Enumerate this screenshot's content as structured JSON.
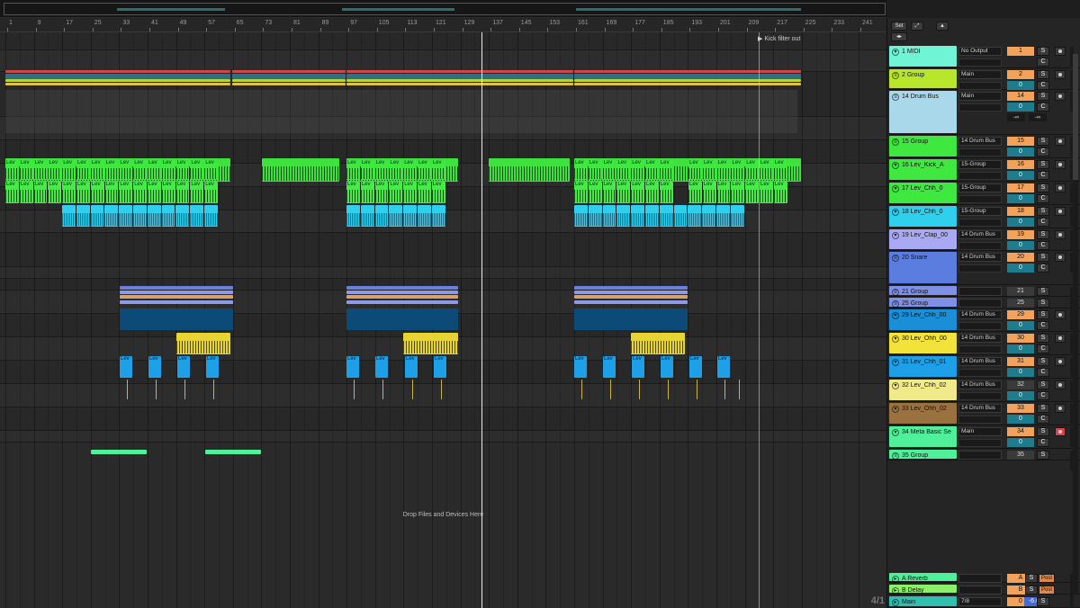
{
  "ruler": {
    "ticks": [
      "1",
      "9",
      "17",
      "25",
      "33",
      "41",
      "49",
      "57",
      "65",
      "73",
      "81",
      "89",
      "97",
      "105",
      "113",
      "121",
      "129",
      "137",
      "145",
      "153",
      "161",
      "169",
      "177",
      "185",
      "193",
      "201",
      "209",
      "217",
      "225",
      "233",
      "241"
    ]
  },
  "arrangement": {
    "locator_label": "Kick filter out",
    "drop_hint": "Drop Files and Devices Here",
    "time_signature": "4/1",
    "clip_label": "Lev"
  },
  "mixer": {
    "set_button": "Set",
    "tracks": [
      {
        "id": "t1",
        "name": "1 MIDI",
        "color": "#6ff5d6",
        "route": "No Output",
        "number": "1",
        "volume": "",
        "fold": "▾"
      },
      {
        "id": "t2",
        "name": "2 Group",
        "color": "#b7e62b",
        "route": "Main",
        "number": "2",
        "volume": "0",
        "fold": "≡"
      },
      {
        "id": "t14",
        "name": "14 Drum Bus",
        "color": "#a8d8ea",
        "route": "Main",
        "number": "14",
        "volume": "0",
        "fold": "≡",
        "inf_left": "-∞",
        "inf_right": "-∞"
      },
      {
        "id": "t15",
        "name": "15 Group",
        "color": "#3fe83f",
        "route": "14 Drum Bus",
        "number": "15",
        "volume": "0",
        "fold": "≡"
      },
      {
        "id": "t16",
        "name": "16 Lev_Kick_A",
        "color": "#3fe83f",
        "route": "15-Group",
        "number": "16",
        "volume": "0",
        "fold": "▾"
      },
      {
        "id": "t17",
        "name": "17 Lev_Chh_0",
        "color": "#3fe83f",
        "route": "15-Group",
        "number": "17",
        "volume": "0",
        "fold": "▾"
      },
      {
        "id": "t18",
        "name": "18 Lev_Chh_0",
        "color": "#2fd0ee",
        "route": "15-Group",
        "number": "18",
        "volume": "0",
        "fold": "▾"
      },
      {
        "id": "t19",
        "name": "19 Lev_Clap_00",
        "color": "#a9a9f3",
        "route": "14 Drum Bus",
        "number": "19",
        "volume": "0",
        "fold": "▾"
      },
      {
        "id": "t20",
        "name": "20 Snare",
        "color": "#5b7de0",
        "route": "14 Drum Bus",
        "number": "20",
        "volume": "0",
        "fold": "≡"
      },
      {
        "id": "t21",
        "name": "21 Group",
        "color": "#7f90e6",
        "route": "",
        "number": "21",
        "volume": "",
        "fold": "≡",
        "offnum": true
      },
      {
        "id": "t25",
        "name": "25 Group",
        "color": "#7f90e6",
        "route": "",
        "number": "25",
        "volume": "",
        "fold": "≡",
        "offnum": true
      },
      {
        "id": "t29",
        "name": "29 Lev_Chh_00",
        "color": "#1a8ed6",
        "route": "14 Drum Bus",
        "number": "29",
        "volume": "0",
        "fold": "▾"
      },
      {
        "id": "t30",
        "name": "30 Lev_Ohh_00",
        "color": "#f1e33a",
        "route": "14 Drum Bus",
        "number": "30",
        "volume": "0",
        "fold": "▾"
      },
      {
        "id": "t31",
        "name": "31 Lev_Chh_01",
        "color": "#1ea0e8",
        "route": "14 Drum Bus",
        "number": "31",
        "volume": "0",
        "fold": "▾"
      },
      {
        "id": "t32",
        "name": "32 Lev_Chh_02",
        "color": "#f1ea8a",
        "route": "14 Drum Bus",
        "number": "32",
        "volume": "0",
        "fold": "▾",
        "offnum": true
      },
      {
        "id": "t33",
        "name": "33 Lev_Ohh_02",
        "color": "#9a7240",
        "route": "14 Drum Bus",
        "number": "33",
        "volume": "0",
        "fold": "▾"
      },
      {
        "id": "t34",
        "name": "34 Meta Basic Se",
        "color": "#4ff09a",
        "route": "Main",
        "number": "34",
        "volume": "0",
        "fold": "▾",
        "armred": true
      },
      {
        "id": "t35",
        "name": "35 Group",
        "color": "#4ff09a",
        "route": "",
        "number": "35",
        "volume": "",
        "fold": "≡",
        "offnum": true
      }
    ],
    "returns": [
      {
        "id": "ra",
        "name": "A Reverb",
        "color": "#4ff09a",
        "number": "A",
        "post": "Post"
      },
      {
        "id": "rb",
        "name": "B Delay",
        "color": "#8cf06a",
        "number": "B",
        "post": "Post"
      }
    ],
    "master": {
      "name": "Main",
      "color": "#2fc0b0",
      "route": "7/8",
      "number": "0",
      "volume": "-6.0"
    }
  }
}
